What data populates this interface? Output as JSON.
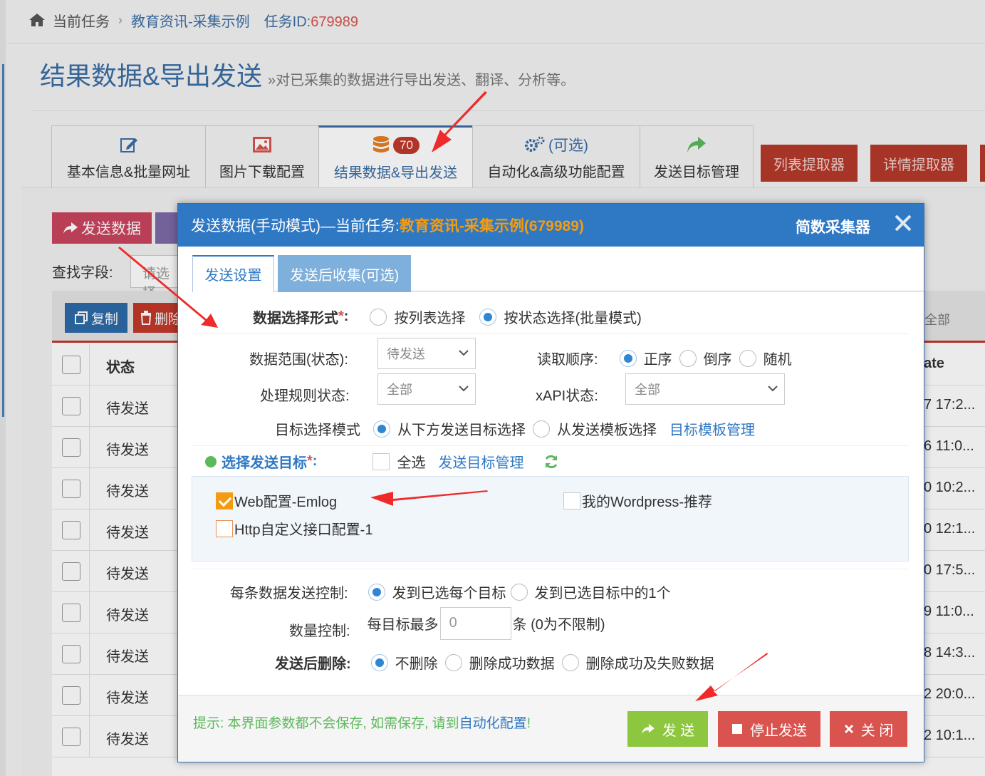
{
  "breadcrumb": {
    "current_task_label": "当前任务",
    "separator": "›",
    "task_name": "教育资讯-采集示例",
    "task_id_label": "任务ID:",
    "task_id": "679989"
  },
  "page": {
    "title": "结果数据&导出发送",
    "subtitle": "»对已采集的数据进行导出发送、翻译、分析等。"
  },
  "tabs": [
    {
      "label": "基本信息&批量网址",
      "icon": "edit-icon"
    },
    {
      "label": "图片下载配置",
      "icon": "image-icon"
    },
    {
      "label": "结果数据&导出发送",
      "icon": "database-icon",
      "badge": "70"
    },
    {
      "label": "自动化&高级功能配置",
      "icon": "gears-icon",
      "extra": "(可选)"
    },
    {
      "label": "发送目标管理",
      "icon": "share-icon"
    }
  ],
  "right_buttons": {
    "list_extractor": "列表提取器",
    "detail_extractor": "详情提取器"
  },
  "toolbar": {
    "send_data": "发送数据",
    "search_field_label": "查找字段:",
    "search_placeholder": "请选择",
    "copy": "复制",
    "delete": "删除",
    "all": "全部"
  },
  "table": {
    "header_status": "状态",
    "header_date": "ate",
    "rows": [
      {
        "status": "待发送",
        "date": "7 17:2..."
      },
      {
        "status": "待发送",
        "date": "6 11:0..."
      },
      {
        "status": "待发送",
        "date": "0 10:2..."
      },
      {
        "status": "待发送",
        "date": "0 12:1..."
      },
      {
        "status": "待发送",
        "date": "0 17:5..."
      },
      {
        "status": "待发送",
        "date": "9 11:0..."
      },
      {
        "status": "待发送",
        "date": "8 14:3..."
      },
      {
        "status": "待发送",
        "date": "2 20:0..."
      },
      {
        "status": "待发送",
        "date": "2 10:1..."
      }
    ]
  },
  "modal": {
    "title_prefix": "发送数据(手动模式)—当前任务: ",
    "title_task": "教育资讯-采集示例(679989)",
    "brand": "简数采集器",
    "tab_send_settings": "发送设置",
    "tab_after_send": "发送后收集(可选)",
    "data_select_label": "数据选择形式",
    "data_select_options": [
      "按列表选择",
      "按状态选择(批量模式)"
    ],
    "data_range_label": "数据范围(状态):",
    "data_range_value": "待发送",
    "read_order_label": "读取顺序:",
    "read_order_options": [
      "正序",
      "倒序",
      "随机"
    ],
    "rule_status_label": "处理规则状态:",
    "rule_status_value": "全部",
    "xapi_label": "xAPI状态:",
    "xapi_value": "全部",
    "target_mode_label": "目标选择模式",
    "target_mode_options": [
      "从下方发送目标选择",
      "从发送模板选择"
    ],
    "template_manage_link": "目标模板管理",
    "select_target_label": "选择发送目标",
    "select_all": "全选",
    "target_manage_link": "发送目标管理",
    "targets": [
      {
        "label": "Web配置-Emlog",
        "checked": true
      },
      {
        "label": "我的Wordpress-推荐",
        "checked": false
      },
      {
        "label": "Http自定义接口配置-1",
        "checked": false
      }
    ],
    "per_data_label": "每条数据发送控制:",
    "per_data_options": [
      "发到已选每个目标",
      "发到已选目标中的1个"
    ],
    "quantity_label": "数量控制:",
    "quantity_prefix": "每目标最多",
    "quantity_value": "0",
    "quantity_suffix": "条 (0为不限制)",
    "delete_after_label": "发送后删除:",
    "delete_after_options": [
      "不删除",
      "删除成功数据",
      "删除成功及失败数据"
    ],
    "hint_prefix": "提示: 本界面参数都不会保存, 如需保存, 请到",
    "hint_link": "自动化配置",
    "hint_suffix": "!",
    "btn_send": "发 送",
    "btn_stop": "停止发送",
    "btn_close": "关 闭"
  },
  "colors": {
    "primary": "#2f78c4",
    "task_highlight": "#f39c12",
    "send_green": "#8dc63f",
    "stop_red": "#d9534f",
    "annotation_arrow": "#ee2a2a"
  }
}
